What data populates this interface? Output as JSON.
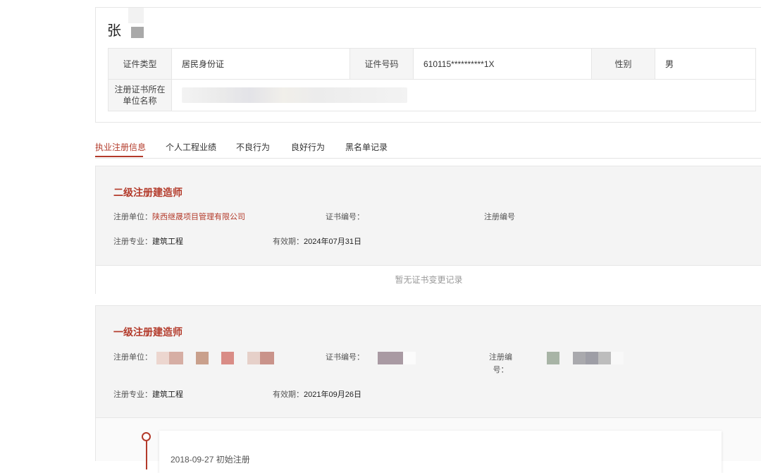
{
  "profile": {
    "name": "张",
    "table": {
      "id_type_label": "证件类型",
      "id_type_value": "居民身份证",
      "id_number_label": "证件号码",
      "id_number_value": "610115**********1X",
      "gender_label": "性别",
      "gender_value": "男",
      "unit_label": "注册证书所在单位名称"
    }
  },
  "tabs": [
    {
      "label": "执业注册信息"
    },
    {
      "label": "个人工程业绩"
    },
    {
      "label": "不良行为"
    },
    {
      "label": "良好行为"
    },
    {
      "label": "黑名单记录"
    }
  ],
  "cert_level2": {
    "title": "二级注册建造师",
    "unit_label": "注册单位：",
    "unit_value": "陕西继晟项目管理有限公司",
    "cert_no_label": "证书编号：",
    "reg_no_label": "注册编号",
    "major_label": "注册专业：",
    "major_value": "建筑工程",
    "valid_label": "有效期：",
    "valid_value": "2024年07月31日",
    "no_change": "暂无证书变更记录"
  },
  "cert_level1": {
    "title": "一级注册建造师",
    "unit_label": "注册单位：",
    "cert_no_label": "证书编号：",
    "reg_no_label_line1": "注册编",
    "reg_no_label_line2": "号：",
    "major_label": "注册专业：",
    "major_value": "建筑工程",
    "valid_label": "有效期：",
    "valid_value": "2021年09月26日"
  },
  "timeline": {
    "entry": "2018-09-27  初始注册"
  },
  "colors": {
    "accent": "#b33a2a",
    "panel_bg": "#f4f4f4",
    "border": "#e6e6e6"
  }
}
